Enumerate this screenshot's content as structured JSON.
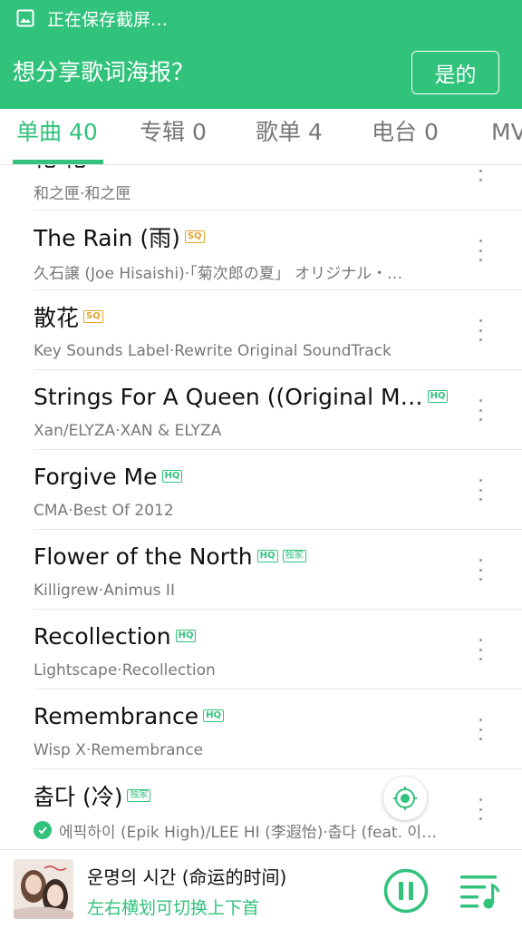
{
  "status": {
    "text": "正在保存截屏…"
  },
  "banner": {
    "text": "想分享歌词海报？",
    "button": "是的"
  },
  "tabs": [
    {
      "label": "单曲 40"
    },
    {
      "label": "专辑 0"
    },
    {
      "label": "歌单 4"
    },
    {
      "label": "电台 0"
    },
    {
      "label": "MV"
    }
  ],
  "songs": [
    {
      "title": "花 花",
      "subtitle": "和之匣·和之匣",
      "badges": []
    },
    {
      "title": "The Rain (雨)",
      "subtitle": "久石譲 (Joe Hisaishi)·「菊次郎の夏」 オリジナル・…",
      "badges": [
        "SQ"
      ]
    },
    {
      "title": "散花",
      "subtitle": "Key Sounds Label·Rewrite Original SoundTrack",
      "badges": [
        "SQ"
      ]
    },
    {
      "title": "Strings For A Queen ((Original M…",
      "subtitle": "Xan/ELYZA·XAN & ELYZA",
      "badges": [
        "HQ"
      ]
    },
    {
      "title": "Forgive Me",
      "subtitle": "CMA·Best Of 2012",
      "badges": [
        "HQ"
      ]
    },
    {
      "title": "Flower of the North",
      "subtitle": "Killigrew·Animus II",
      "badges": [
        "HQ",
        "独家"
      ]
    },
    {
      "title": "Recollection",
      "subtitle": "Lightscape·Recollection",
      "badges": [
        "HQ"
      ]
    },
    {
      "title": "Remembrance",
      "subtitle": "Wisp X·Remembrance",
      "badges": [
        "HQ"
      ]
    },
    {
      "title": "춥다 (冷)",
      "subtitle": "에픽하이 (Epik High)/LEE HI (李遐怡)·춥다 (feat. 이…",
      "badges": [
        "独家"
      ]
    }
  ],
  "player": {
    "title": "운명의 시간 (命运的时间)",
    "hint": "左右横划可切换上下首"
  },
  "colors": {
    "accent": "#31c27c",
    "sq": "#e0a531"
  }
}
